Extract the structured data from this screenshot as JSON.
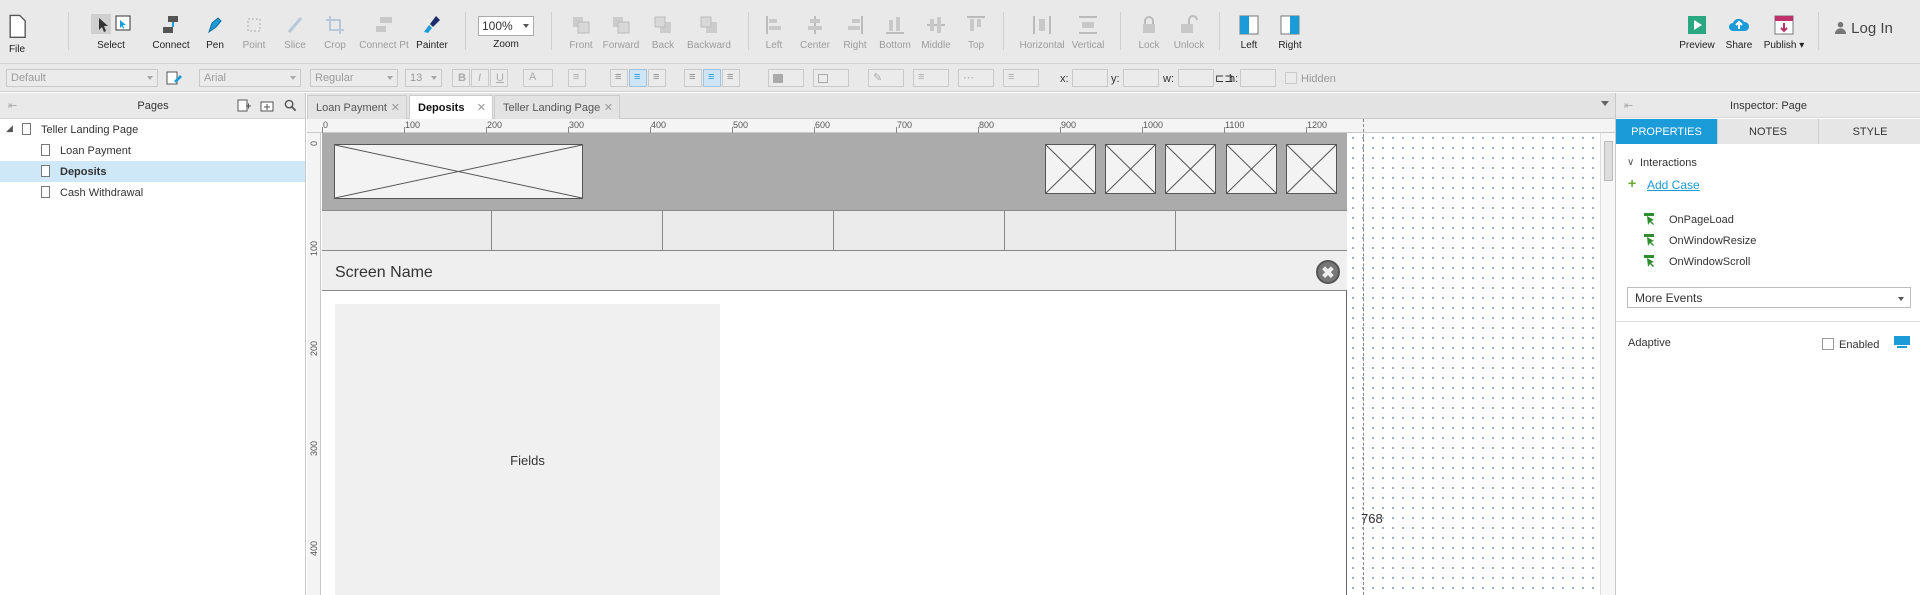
{
  "toolbar": {
    "file": "File",
    "select": "Select",
    "connect": "Connect",
    "pen": "Pen",
    "point": "Point",
    "slice": "Slice",
    "crop": "Crop",
    "connect_pt": "Connect Pt",
    "painter": "Painter",
    "zoom_value": "100%",
    "zoom": "Zoom",
    "front": "Front",
    "forward": "Forward",
    "back": "Back",
    "backward": "Backward",
    "left": "Left",
    "center": "Center",
    "right": "Right",
    "bottom": "Bottom",
    "middle": "Middle",
    "top": "Top",
    "horizontal": "Horizontal",
    "vertical": "Vertical",
    "lock": "Lock",
    "unlock": "Unlock",
    "left2": "Left",
    "right2": "Right",
    "preview": "Preview",
    "share": "Share",
    "publish": "Publish ▾",
    "login": "Log In"
  },
  "formatbar": {
    "style": "Default",
    "font": "Arial",
    "weight": "Regular",
    "size": "13",
    "x_label": "x:",
    "y_label": "y:",
    "w_label": "w:",
    "h_label": "h:",
    "hidden": "Hidden"
  },
  "pages": {
    "title": "Pages",
    "items": [
      {
        "label": "Teller Landing Page"
      },
      {
        "label": "Loan Payment"
      },
      {
        "label": "Deposits"
      },
      {
        "label": "Cash Withdrawal"
      }
    ]
  },
  "tabs": [
    {
      "label": "Loan Payment"
    },
    {
      "label": "Deposits"
    },
    {
      "label": "Teller Landing Page"
    }
  ],
  "ruler": {
    "h": [
      "0",
      "100",
      "200",
      "300",
      "400",
      "500",
      "600",
      "700",
      "800",
      "900",
      "1000",
      "1100",
      "1200"
    ],
    "v": [
      "0",
      "100",
      "200",
      "300",
      "400"
    ]
  },
  "wireframe": {
    "screen_name": "Screen Name",
    "close": "✖",
    "fields": "Fields",
    "breakpoint": "768"
  },
  "inspector": {
    "title": "Inspector: Page",
    "tabs": [
      "PROPERTIES",
      "NOTES",
      "STYLE"
    ],
    "interactions": "Interactions",
    "add_case": "Add Case",
    "events": [
      "OnPageLoad",
      "OnWindowResize",
      "OnWindowScroll"
    ],
    "more_events": "More Events",
    "adaptive": "Adaptive",
    "enabled": "Enabled"
  },
  "colors": {
    "accent": "#1b9bd7",
    "green": "#6aa82e",
    "publish_pink": "#c0306b"
  }
}
